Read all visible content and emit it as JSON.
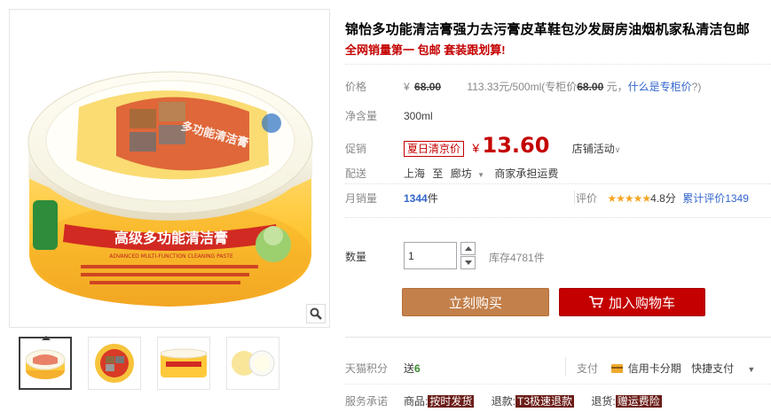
{
  "product": {
    "title": "锦怡多功能清洁膏强力去污膏皮革鞋包沙发厨房油烟机家私清洁包邮",
    "subtitle": "全网销量第一 包邮 套装跟划算!"
  },
  "gallery": {
    "zoom_icon": "magnifier-icon",
    "thumbnails": [
      "thumb-1",
      "thumb-2",
      "thumb-3",
      "thumb-4"
    ],
    "main_image": {
      "tub_label": "高级多功能清洁膏",
      "tub_label_en": "ADVANCED MULTI-FUNCTION CLEANING PASTE",
      "lid_text": "多功能清洁膏"
    }
  },
  "price": {
    "label": "价格",
    "currency": "¥",
    "original": "68.00",
    "unit_price": "113.33元/500ml",
    "counter_prefix": "(专柜价",
    "counter_price": "68.00",
    "counter_suffix": "元，",
    "counter_link": "什么是专柜价",
    "counter_close": "?)"
  },
  "volume": {
    "label": "净含量",
    "value": "300ml"
  },
  "promo": {
    "label": "促销",
    "tag": "夏日清京价",
    "currency": "¥",
    "price": "13.60",
    "store_activity": "店铺活动"
  },
  "shipping": {
    "label": "配送",
    "from": "上海",
    "to_word": "至",
    "to": "廊坊",
    "note": "商家承担运费"
  },
  "sales": {
    "label": "月销量",
    "count": "1344",
    "unit": "件",
    "rating_label": "评价",
    "stars": "★★★★★",
    "score": "4.8分",
    "reviews": "累计评价1349"
  },
  "quantity": {
    "label": "数量",
    "value": "1",
    "stock": "库存4781件"
  },
  "buttons": {
    "buy_now": "立刻购买",
    "add_to_cart": "加入购物车"
  },
  "tmall_points": {
    "label": "天猫积分",
    "prefix": "送",
    "value": "6"
  },
  "payment": {
    "label": "支付",
    "credit": "信用卡分期",
    "express": "快捷支付"
  },
  "service": {
    "label": "服务承诺",
    "goods_label": "商品:",
    "goods_tag": "按时发货",
    "return_label": "退款:",
    "return_tag": "T3极速退款",
    "ship_label": "退货:",
    "ship_tag": "赠运费险"
  },
  "colors": {
    "accent_red": "#c40000",
    "buy_brown": "#c3804b",
    "link_blue": "#3366cc",
    "service_tag": "#6b1d18"
  }
}
